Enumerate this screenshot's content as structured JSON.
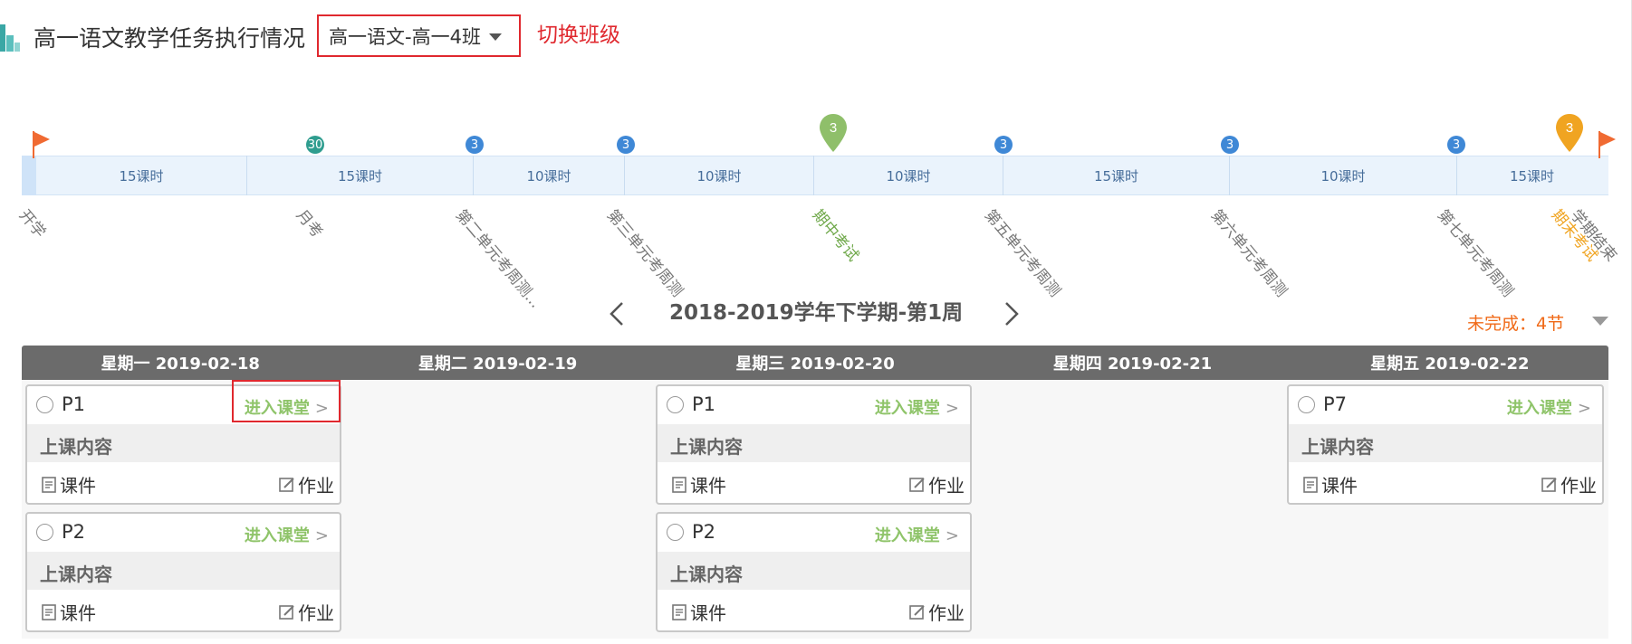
{
  "header": {
    "title": "高一语文教学任务执行情况",
    "class_select": "高一语文-高一4班",
    "switch_note": "切换班级"
  },
  "timeline": {
    "segments": [
      "15课时",
      "15课时",
      "10课时",
      "10课时",
      "10课时",
      "15课时",
      "10课时",
      "15课时"
    ],
    "markers": [
      "30",
      "3",
      "3",
      "3",
      "3",
      "3",
      "3",
      "3"
    ],
    "labels": [
      "开学",
      "月考",
      "第二单元考周测...",
      "第三单元考周测",
      "期中考试",
      "第五单元考周测",
      "第六单元考周测",
      "第七单元考周测",
      "期末考试",
      "学期结束"
    ],
    "colors": {
      "blue": "#3f88d6",
      "teal": "#2f9d8f",
      "green": "#8fbf6a",
      "orange": "#f0a421",
      "flag": "#f06a32"
    }
  },
  "week": {
    "title": "2018-2019学年下学期-第1周",
    "incomplete": "未完成：4节"
  },
  "schedule": {
    "days": [
      "星期一  2019-02-18",
      "星期二  2019-02-19",
      "星期三  2019-02-20",
      "星期四  2019-02-21",
      "星期五  2019-02-22"
    ],
    "cards": [
      {
        "period": "P1",
        "enter": "进入课堂",
        "content": "上课内容",
        "courseware": "课件",
        "homework": "作业"
      },
      {
        "period": "P2",
        "enter": "进入课堂",
        "content": "上课内容",
        "courseware": "课件",
        "homework": "作业"
      },
      {
        "period": "P1",
        "enter": "进入课堂",
        "content": "上课内容",
        "courseware": "课件",
        "homework": "作业"
      },
      {
        "period": "P2",
        "enter": "进入课堂",
        "content": "上课内容",
        "courseware": "课件",
        "homework": "作业"
      },
      {
        "period": "P7",
        "enter": "进入课堂",
        "content": "上课内容",
        "courseware": "课件",
        "homework": "作业"
      }
    ]
  }
}
